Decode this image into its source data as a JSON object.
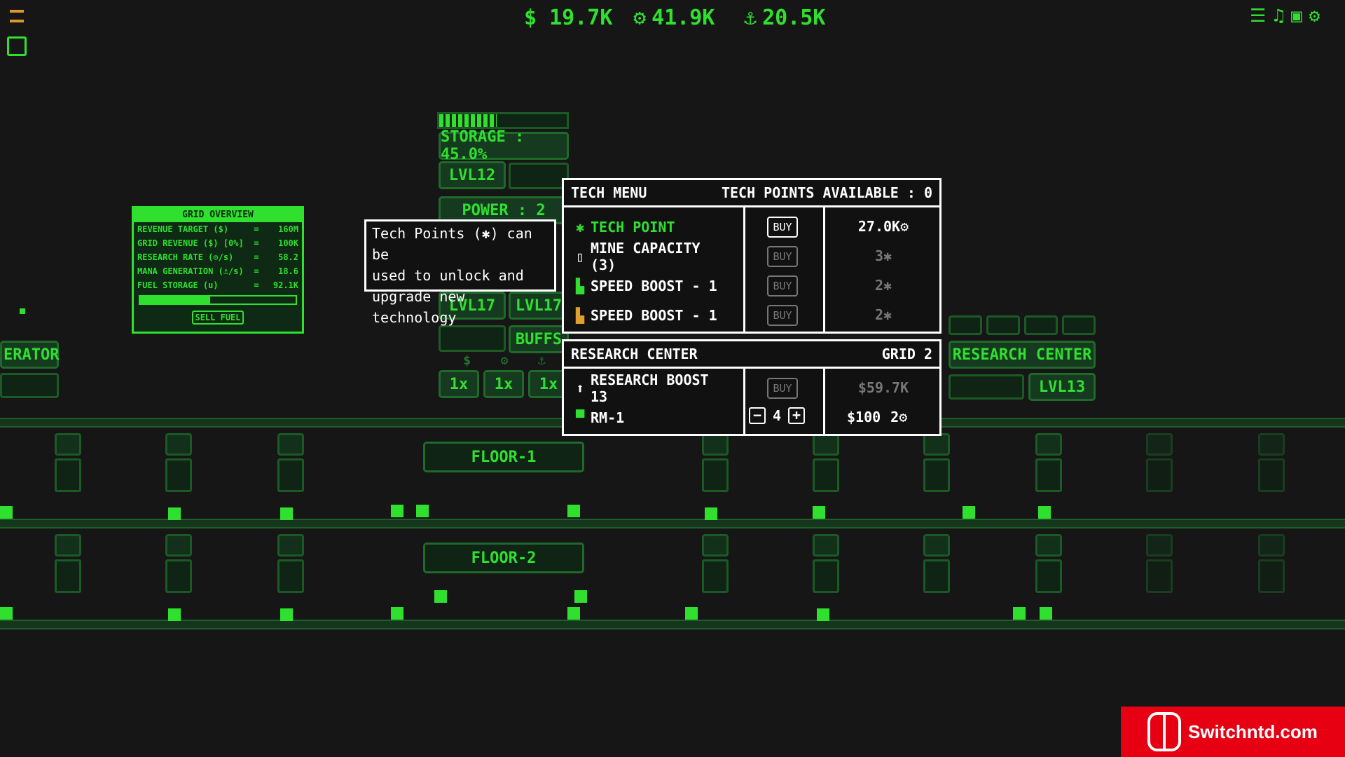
{
  "hud": {
    "money": "$ 19.7K",
    "research": "41.9K",
    "mana": "20.5K",
    "money_icon": "dollar-icon",
    "research_icon": "gear-icon",
    "mana_icon": "anchor-icon"
  },
  "top_right_icons": [
    "list-icon",
    "music-icon",
    "save-icon",
    "settings-icon"
  ],
  "center_machine": {
    "storage": "STORAGE : 45.0%",
    "level": "LVL12",
    "power": "POWER : 2",
    "lvl_a": "LVL17",
    "lvl_b": "LVL17",
    "buffs": "BUFFS",
    "mult1": "1x",
    "mult2": "1x",
    "mult3": "1x",
    "storage_fill": 0.45
  },
  "left_machine": {
    "label": "ERATOR"
  },
  "right_machine": {
    "label": "RESEARCH CENTER",
    "level": "LVL13"
  },
  "grid_overview": {
    "title": "GRID OVERVIEW",
    "rows": [
      {
        "k": "REVENUE TARGET ($)",
        "v": "160M"
      },
      {
        "k": "GRID REVENUE ($) [0%]",
        "v": "100K"
      },
      {
        "k": "RESEARCH RATE (⚙/s)",
        "v": "58.2"
      },
      {
        "k": "MANA GENERATION (⚓/s)",
        "v": "18.6"
      },
      {
        "k": "FUEL STORAGE (u)",
        "v": "92.1K"
      }
    ],
    "fuel_fill": 0.45,
    "sell_label": "SELL FUEL"
  },
  "tooltip": {
    "line1": "Tech Points (✱) can be",
    "line2": "used to unlock and",
    "line3": "upgrade new technology"
  },
  "tech_menu": {
    "title": "TECH MENU",
    "points": "TECH POINTS AVAILABLE : 0",
    "items": [
      {
        "label": "TECH POINT",
        "buy": "BUY",
        "price": "27.0K⚙",
        "highlight": true
      },
      {
        "label": "MINE CAPACITY (3)",
        "buy": "BUY",
        "price": "3✱"
      },
      {
        "label": "SPEED BOOST - 1",
        "buy": "BUY",
        "price": "2✱"
      },
      {
        "label": "SPEED BOOST - 1",
        "buy": "BUY",
        "price": "2✱"
      }
    ]
  },
  "research_center": {
    "title": "RESEARCH CENTER",
    "grid": "GRID 2",
    "boost_label": "RESEARCH BOOST 13",
    "boost_buy": "BUY",
    "boost_price": "$59.7K",
    "rm_label": "RM-1",
    "rm_count": "4",
    "rm_price": "$100",
    "rm_research": "2⚙"
  },
  "floors": {
    "floor1": "FLOOR-1",
    "floor2": "FLOOR-2"
  },
  "watermark": {
    "text": "Switchntd.com"
  },
  "colors": {
    "accent": "#2fe02f",
    "background": "#161616",
    "badge": "#e60012"
  }
}
